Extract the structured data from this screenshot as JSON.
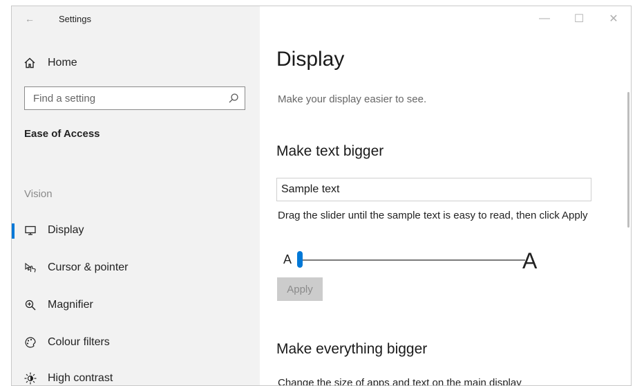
{
  "window": {
    "title": "Settings",
    "controls": {
      "minimize": "—",
      "maximize": "☐",
      "close": "✕"
    }
  },
  "sidebar": {
    "home_label": "Home",
    "search": {
      "placeholder": "Find a setting"
    },
    "section_title": "Ease of Access",
    "group_label": "Vision",
    "items": [
      {
        "label": "Display",
        "icon": "display-icon",
        "active": true
      },
      {
        "label": "Cursor & pointer",
        "icon": "cursor-pointer-icon",
        "active": false
      },
      {
        "label": "Magnifier",
        "icon": "magnifier-icon",
        "active": false
      },
      {
        "label": "Colour filters",
        "icon": "colour-filters-icon",
        "active": false
      },
      {
        "label": "High contrast",
        "icon": "high-contrast-icon",
        "active": false
      }
    ]
  },
  "main": {
    "title": "Display",
    "subtitle": "Make your display easier to see.",
    "text_bigger": {
      "heading": "Make text bigger",
      "sample_text": "Sample text",
      "instructions": "Drag the slider until the sample text is easy to read, then click Apply",
      "slider_min_label": "A",
      "slider_max_label": "A",
      "apply_label": "Apply"
    },
    "everything_bigger": {
      "heading": "Make everything bigger",
      "description": "Change the size of apps and text on the main display"
    }
  },
  "colors": {
    "accent": "#0078d7",
    "sidebar_bg": "#f2f2f2",
    "apply_disabled_bg": "#cccccc"
  }
}
